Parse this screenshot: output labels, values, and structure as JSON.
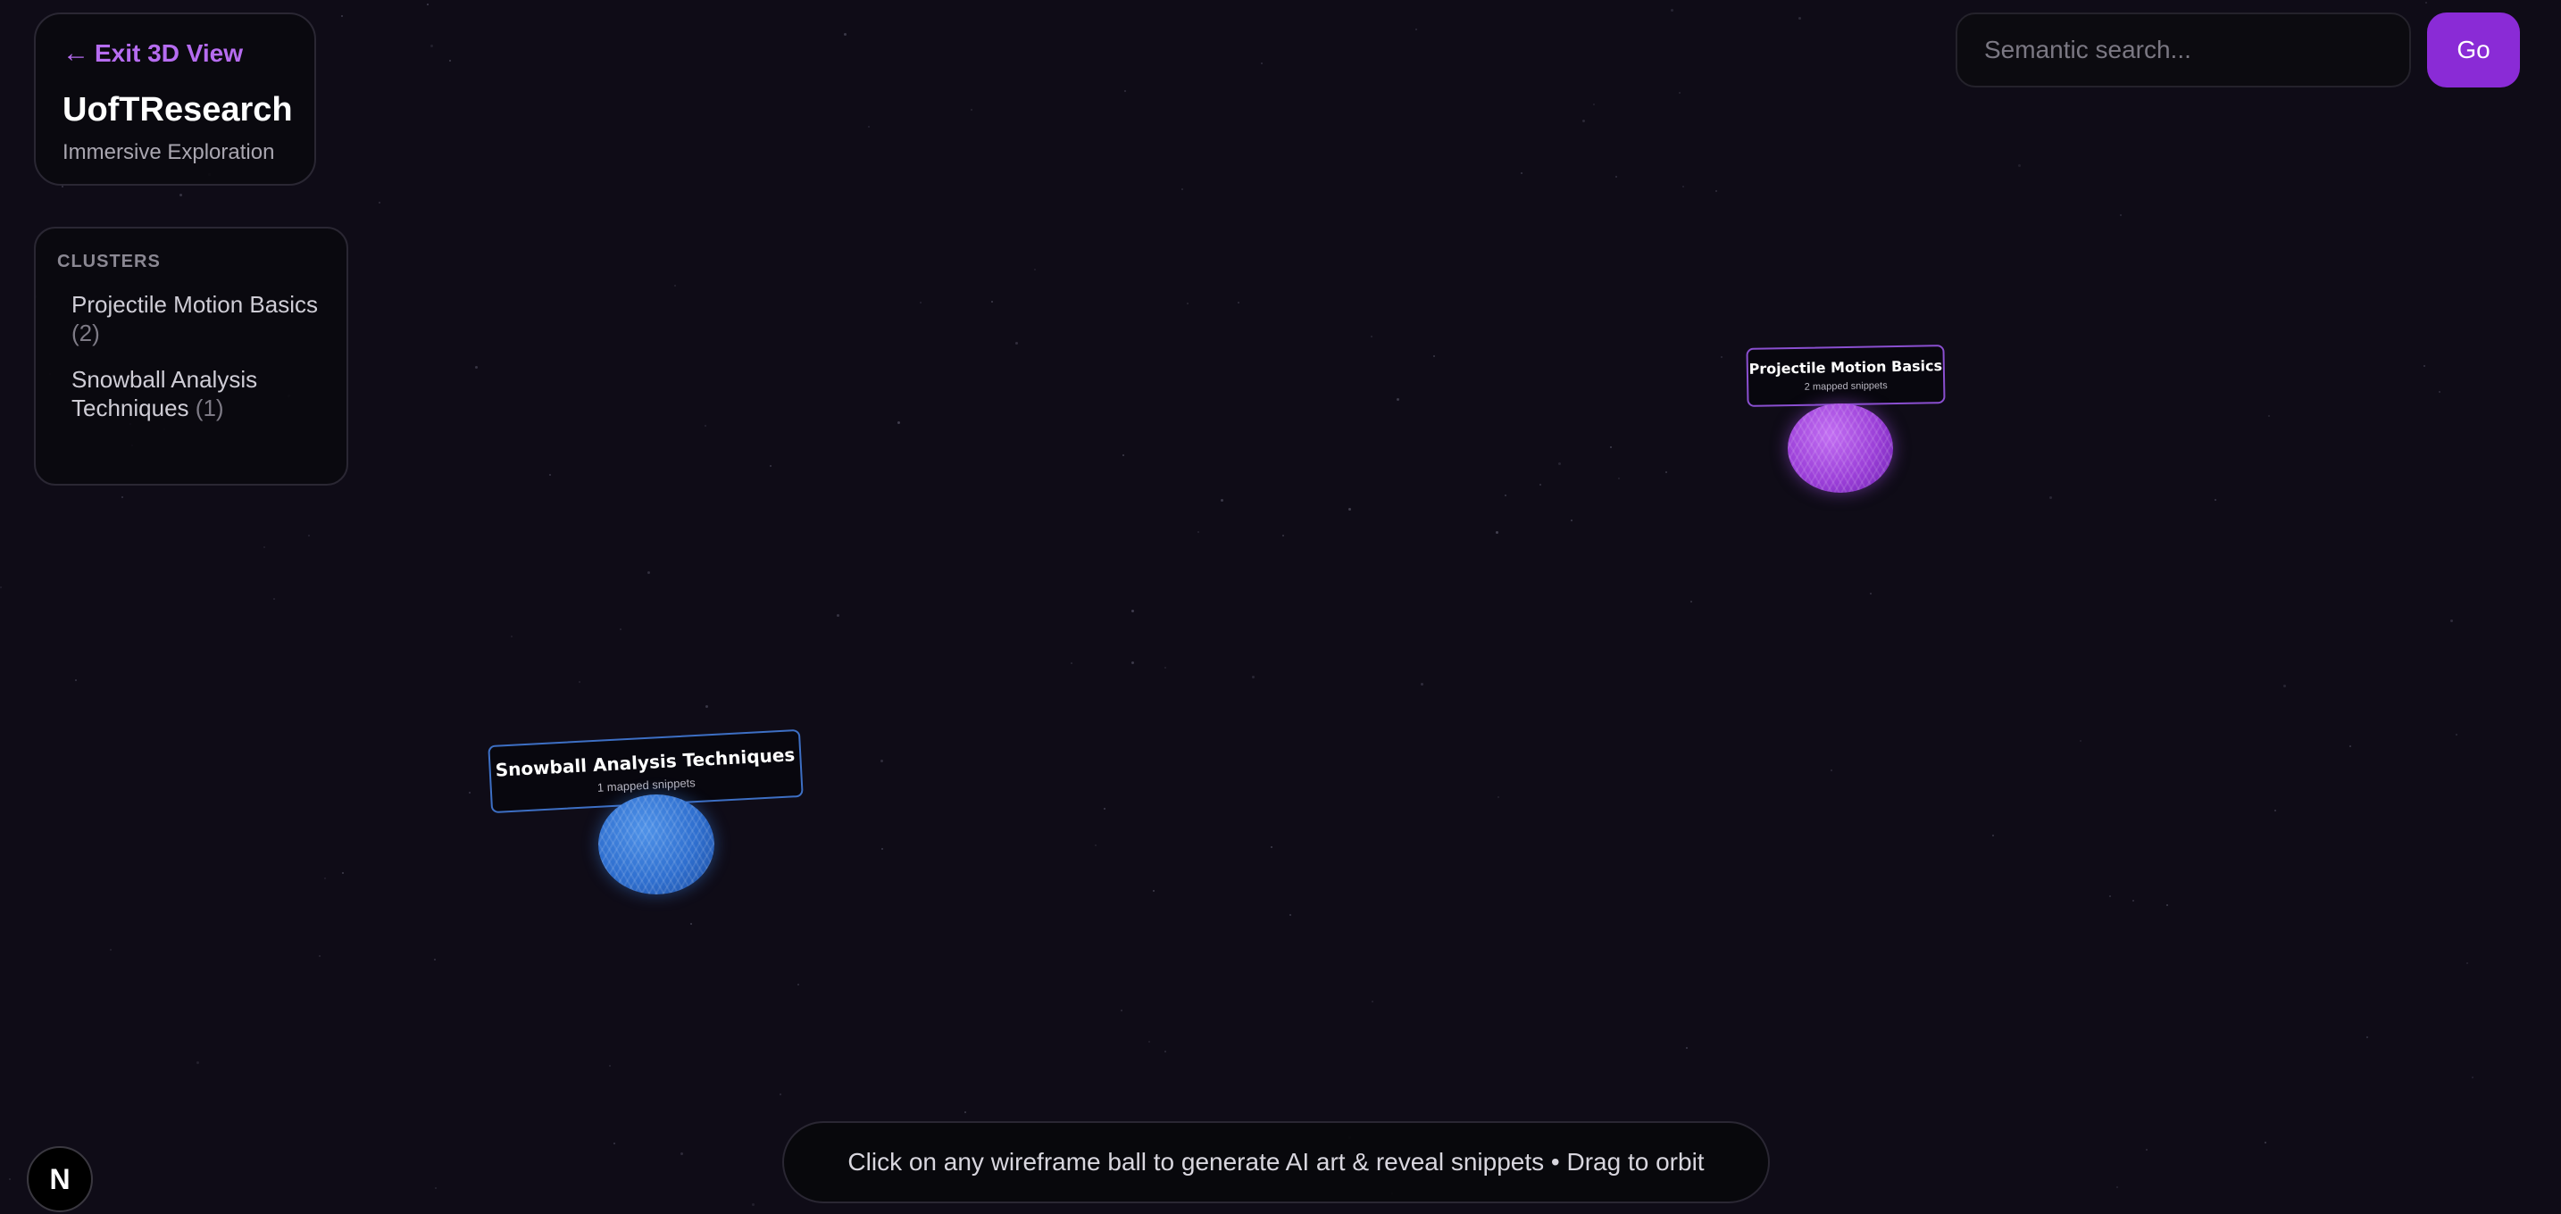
{
  "header": {
    "exit_label": "Exit 3D View",
    "title": "UofTResearch",
    "subtitle": "Immersive Exploration"
  },
  "clusters_panel": {
    "heading": "CLUSTERS",
    "items": [
      {
        "name": "Projectile Motion Basics",
        "count": "(2)"
      },
      {
        "name": "Snowball Analysis Techniques",
        "count": "(1)"
      }
    ]
  },
  "search": {
    "placeholder": "Semantic search...",
    "button_label": "Go"
  },
  "scene": {
    "nodes": [
      {
        "title": "Projectile Motion Basics",
        "subtitle": "2 mapped snippets",
        "color": "#a04ee0"
      },
      {
        "title": "Snowball Analysis Techniques",
        "subtitle": "1 mapped snippets",
        "color": "#3a7ddb"
      }
    ]
  },
  "hint": "Click on any wireframe ball to generate AI art & reveal snippets • Drag to orbit",
  "badge": "N",
  "colors": {
    "background": "#0f0c17",
    "accent": "#8a2bd6",
    "link": "#b66cf0"
  }
}
